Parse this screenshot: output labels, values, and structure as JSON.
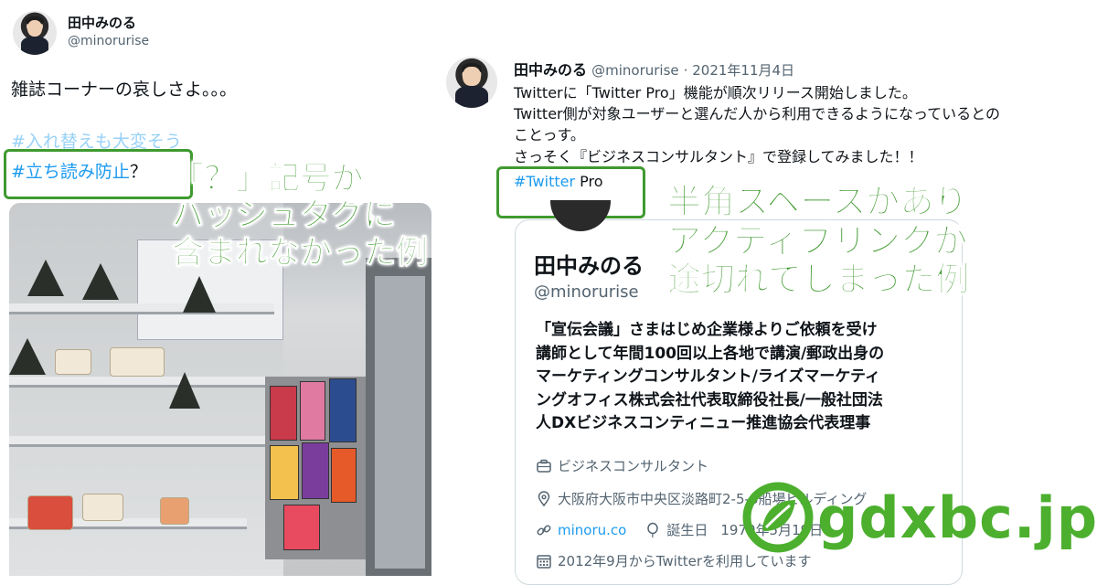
{
  "left_tweet": {
    "user_name": "田中みのる",
    "handle": "@minorurise",
    "text": "雑誌コーナーの哀しさよ。。。",
    "hashtag_faded": "#入れ替えも大変そう",
    "hashtag": "#立ち読み防止",
    "after_hashtag": "？"
  },
  "left_annotation": {
    "line1": "「？」記号が",
    "line2": "ハッシュタグに",
    "line3": "含まれなかった例"
  },
  "right_tweet": {
    "user_name": "田中みのる",
    "handle": "@minorurise",
    "date": "· 2021年11月4日",
    "line1": "Twitterに「Twitter Pro」機能が順次リリース開始しました。",
    "line2": "Twitter側が対象ユーザーと選んだ人から利用できるようになっているとの",
    "line3": "ことっす。",
    "line4": "さっそく『ビジネスコンサルタント』で登録してみました！！",
    "hashtag": "#Twitter",
    "after_hashtag": " Pro"
  },
  "right_annotation": {
    "line1": "半角スペースがあり",
    "line2": "アクティブリンクが",
    "line3": "途切れてしまった例"
  },
  "profile_card": {
    "name": "田中みのる",
    "handle": "@minorurise",
    "bio": [
      "「宣伝会議」さまはじめ企業様よりご依頼を受け",
      "講師として年間100回以上各地で講演/郵政出身の",
      "マーケティングコンサルタント/ライズマーケティ",
      "ングオフィス株式会社代表取締役社長/一般社団法",
      "人DXビジネスコンティニュー推進協会代表理事"
    ],
    "category": "ビジネスコンサルタント",
    "location": "大阪府大阪市中央区淡路町2-5-8船場ビルディング",
    "link": "minoru.co",
    "birthday_label": "誕生日",
    "birthday": "1970年5月19日",
    "joined": "2012年9月からTwitterを利用しています"
  },
  "watermark": "gdxbc.jp",
  "colors": {
    "annotation_green": "#3f9a2f",
    "link_blue": "#1d9bf0",
    "watermark_green": "#4caf2e"
  }
}
